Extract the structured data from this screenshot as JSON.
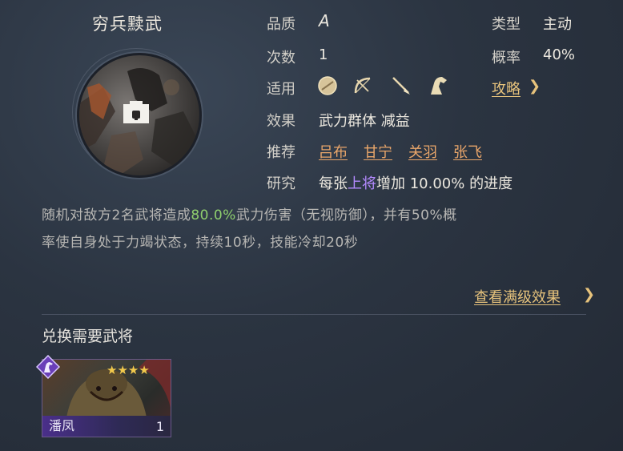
{
  "skill": {
    "name": "穷兵黩武",
    "icon": "lock-icon"
  },
  "info": {
    "quality_label": "品质",
    "quality_value": "A",
    "type_label": "类型",
    "type_value": "主动",
    "count_label": "次数",
    "count_value": "1",
    "rate_label": "概率",
    "rate_value": "40%",
    "applies_label": "适用",
    "applies_icons": [
      "shield-icon",
      "bow-icon",
      "spear-icon",
      "horse-icon"
    ],
    "guide_label": "攻略",
    "effect_label": "效果",
    "effect_value": "武力群体 减益",
    "recommend_label": "推荐",
    "recommend": [
      "吕布",
      "甘宁",
      "关羽",
      "张飞"
    ],
    "research_label": "研究",
    "research_prefix": "每张",
    "research_highlight": "上将",
    "research_suffix": "增加 10.00% 的进度"
  },
  "description": {
    "part1": "随机对敌方2名武将造成",
    "highlight": "80.0%",
    "part2": "武力伤害（无视防御），并有50%概",
    "line2": "率使自身处于力竭状态，持续10秒，技能冷却20秒"
  },
  "view_full_link": "查看满级效果",
  "exchange": {
    "title": "兑换需要武将",
    "card": {
      "name": "潘凤",
      "count": "1",
      "stars": 4,
      "badge_icon": "horse-icon",
      "star_char": "★"
    }
  },
  "colors": {
    "accent_gold": "#e7c37c",
    "link_orange": "#e9a66a",
    "highlight_green": "#8fcf6e",
    "highlight_purple": "#b48aff"
  }
}
